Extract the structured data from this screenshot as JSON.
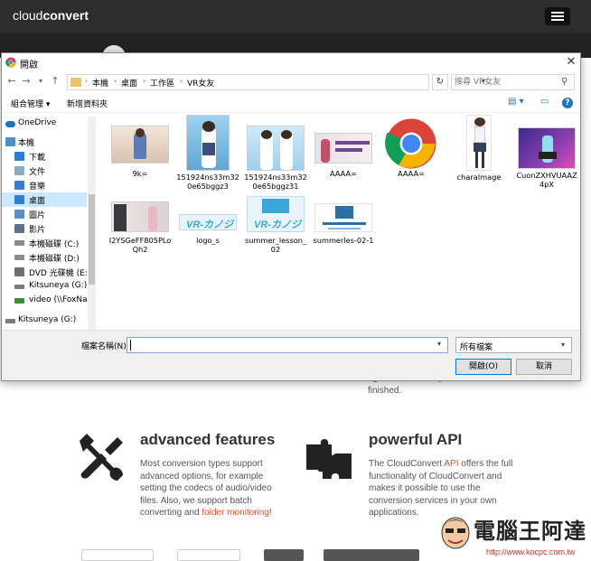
{
  "site": {
    "logo_light": "cloud",
    "logo_bold": "convert",
    "hero_text": "again as soon as your conversion is finished."
  },
  "features": [
    {
      "icon": "wrench-screwdriver-icon",
      "title": "advanced features",
      "text_before": "Most conversion types support advanced options, for example setting the codecs of audio/video files. Also, we support batch converting and ",
      "link": "folder monitoring",
      "text_after": "!"
    },
    {
      "icon": "puzzle-icon",
      "title": "powerful API",
      "text_before": "The CloudConvert ",
      "link": "API",
      "text_after": " offers the full functionality of CloudConvert and makes it possible to use the conversion services in your own applications."
    }
  ],
  "watermark": {
    "title": "電腦王阿達",
    "url": "http://www.kocpc.com.tw"
  },
  "dialog": {
    "title": "開啟",
    "close": "✕",
    "breadcrumb": [
      "本機",
      "桌面",
      "工作區",
      "VR女友"
    ],
    "search_placeholder": "搜尋 VR女友",
    "toolbar": {
      "organize": "組合管理 ▾",
      "new_folder": "新增資料夾"
    },
    "help": "?",
    "nav_items": [
      {
        "label": "OneDrive",
        "icon": "cloud-icon",
        "color": "#1e73c9",
        "selected": false
      },
      {
        "label": "本機",
        "icon": "computer-icon",
        "color": "#4a90c4",
        "selected": false
      },
      {
        "label": "下載",
        "icon": "download-icon",
        "color": "#2a7fd4",
        "selected": false
      },
      {
        "label": "文件",
        "icon": "document-icon",
        "color": "#8fa8c2",
        "selected": false
      },
      {
        "label": "音樂",
        "icon": "music-icon",
        "color": "#3a7bd5",
        "selected": false
      },
      {
        "label": "桌面",
        "icon": "desktop-icon",
        "color": "#2f80d1",
        "selected": true
      },
      {
        "label": "圖片",
        "icon": "pictures-icon",
        "color": "#5a8fc2",
        "selected": false
      },
      {
        "label": "影片",
        "icon": "video-icon",
        "color": "#5d7189",
        "selected": false
      },
      {
        "label": "本機磁碟 (C:)",
        "icon": "drive-icon",
        "color": "#8a8a8a",
        "selected": false
      },
      {
        "label": "本機磁碟 (D:)",
        "icon": "drive-icon",
        "color": "#8a8a8a",
        "selected": false
      },
      {
        "label": "DVD 光碟機 (E:)",
        "icon": "dvd-icon",
        "color": "#6f6f6f",
        "selected": false
      },
      {
        "label": "Kitsuneya (G:)",
        "icon": "usb-drive-icon",
        "color": "#7a7a7a",
        "selected": false
      },
      {
        "label": "video (\\\\FoxNa",
        "icon": "network-drive-icon",
        "color": "#3c8c3c",
        "selected": false
      },
      {
        "label": "Kitsuneya (G:)",
        "icon": "usb-drive-icon",
        "color": "#7a7a7a",
        "selected": false
      }
    ],
    "files": [
      {
        "name": "9k=",
        "kind": "photo",
        "bg": "#e9d8c9",
        "accent": "#5b7bb5"
      },
      {
        "name": "151924ns33m320e65bggz3",
        "kind": "photo",
        "bg": "#7db8e0",
        "accent": "#3b4f7a"
      },
      {
        "name": "151924ns33m320e65bggz31",
        "kind": "photo",
        "bg": "#bfe1f2",
        "accent": "#2b4a7f"
      },
      {
        "name": "AAAA=",
        "kind": "photo",
        "bg": "#e6dfe8",
        "accent": "#c34f6b"
      },
      {
        "name": "AAAA=",
        "kind": "chrome",
        "bg": "#ffffff",
        "accent": "#4285f4"
      },
      {
        "name": "charaImage",
        "kind": "photo",
        "bg": "#ffffff",
        "accent": "#34405a"
      },
      {
        "name": "CuonZXHVUAAZ4pX",
        "kind": "photo",
        "bg": "#5d3fa8",
        "accent": "#e04db3"
      },
      {
        "name": "I2YSGeFF805PLoQh2",
        "kind": "photo",
        "bg": "#ece2e2",
        "accent": "#445"
      },
      {
        "name": "logo_s",
        "kind": "logo",
        "bg": "#e8f4fb",
        "accent": "#3aa6d9"
      },
      {
        "name": "summer_lesson_02",
        "kind": "logo",
        "bg": "#e8f4fb",
        "accent": "#3aa6d9"
      },
      {
        "name": "summerles-02-1",
        "kind": "logo",
        "bg": "#ffffff",
        "accent": "#2c6fa6"
      }
    ],
    "filename_label": "檔案名稱(N):",
    "filename_value": "",
    "file_type": "所有檔案",
    "open_button": "開啟(O)",
    "cancel_button": "取消"
  }
}
